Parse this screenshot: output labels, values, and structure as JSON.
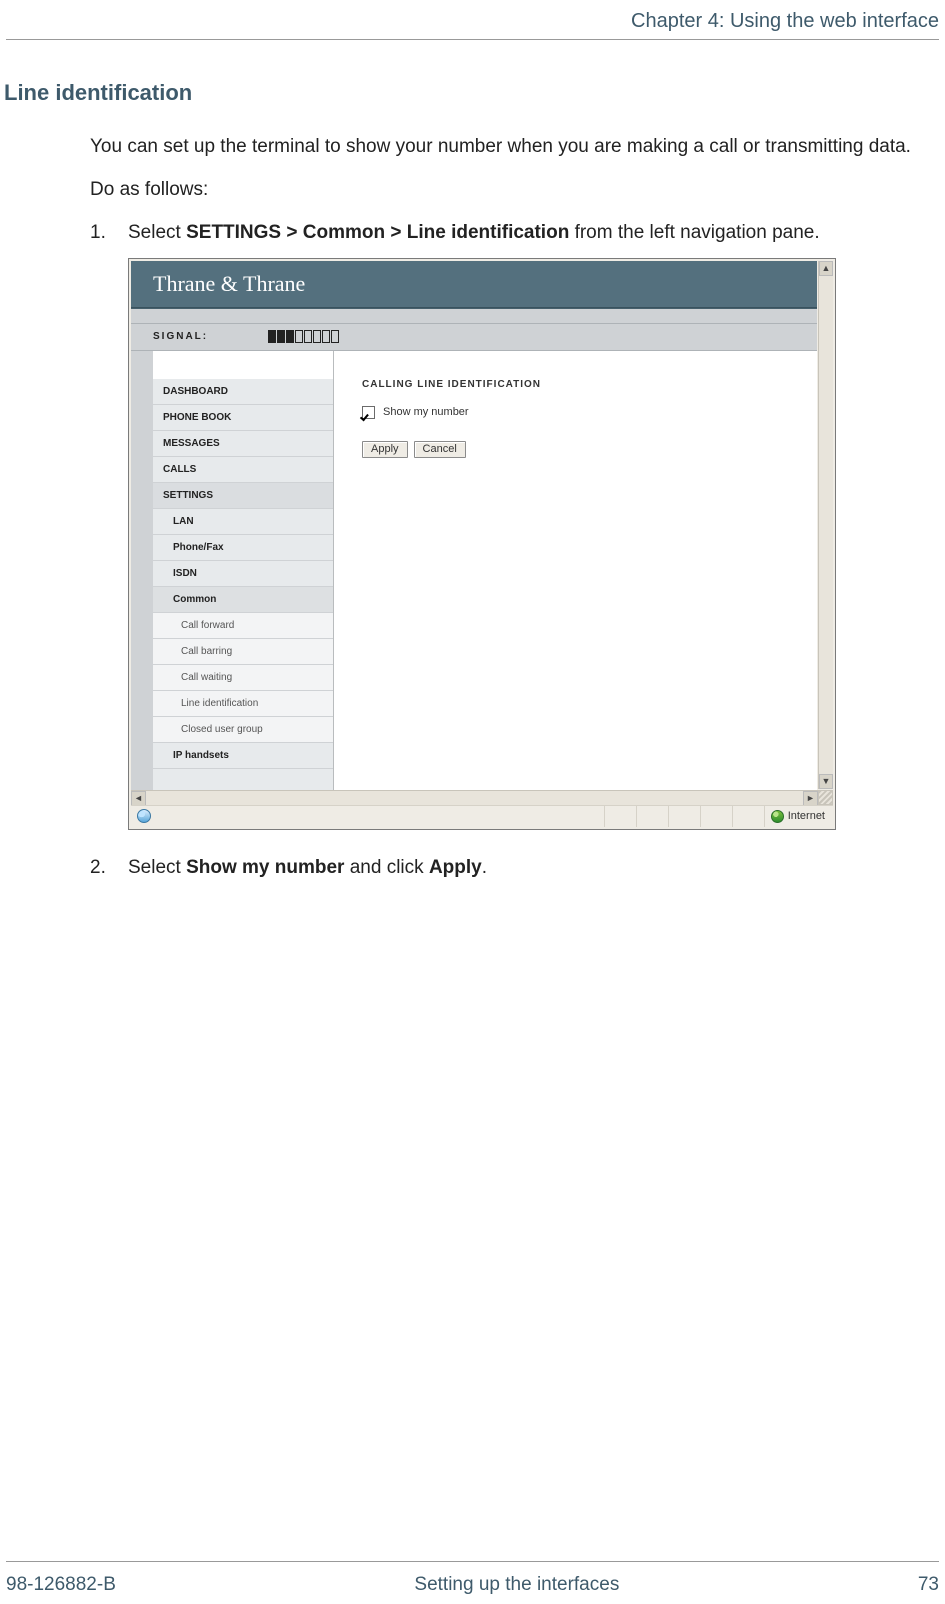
{
  "header": {
    "chapter": "Chapter 4: Using the web interface"
  },
  "section_heading": "Line identification",
  "intro_p1": "You can set up the terminal to show your number when you are making a call or transmitting data.",
  "intro_p2": "Do as follows:",
  "steps": {
    "s1": {
      "num": "1.",
      "prefix": "Select ",
      "bold": "SETTINGS > Common > Line identification",
      "suffix": " from the left navigation pane."
    },
    "s2": {
      "num": "2.",
      "prefix": "Select ",
      "bold1": "Show my number",
      "mid": " and click ",
      "bold2": "Apply",
      "suffix": "."
    }
  },
  "screenshot": {
    "brand": "Thrane & Thrane",
    "signal_label": "SIGNAL:",
    "signal_bars_total": 8,
    "signal_bars_filled": 3,
    "nav": {
      "dashboard": "DASHBOARD",
      "phonebook": "PHONE BOOK",
      "messages": "MESSAGES",
      "calls": "CALLS",
      "settings": "SETTINGS",
      "lan": "LAN",
      "phonefax": "Phone/Fax",
      "isdn": "ISDN",
      "common": "Common",
      "callforward": "Call forward",
      "callbarring": "Call barring",
      "callwaiting": "Call waiting",
      "lineident": "Line identification",
      "closedgroup": "Closed user group",
      "iphandsets": "IP handsets"
    },
    "content": {
      "heading": "CALLING LINE IDENTIFICATION",
      "checkbox_label": "Show my number",
      "checkbox_checked": true,
      "apply": "Apply",
      "cancel": "Cancel"
    },
    "statusbar": {
      "zone": "Internet"
    }
  },
  "footer": {
    "left": "98-126882-B",
    "center": "Setting up the interfaces",
    "right": "73"
  }
}
